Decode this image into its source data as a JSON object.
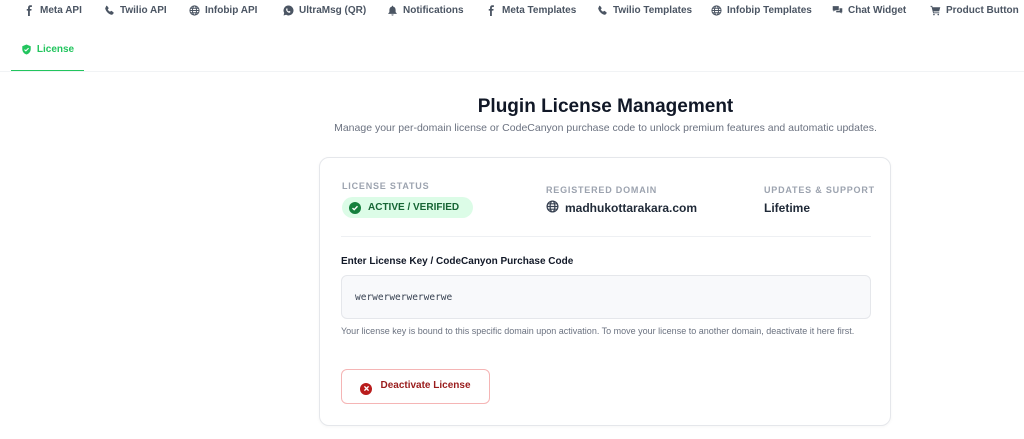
{
  "tabs": [
    {
      "id": "meta-api",
      "label": "Meta API",
      "icon": "facebook-icon"
    },
    {
      "id": "twilio-api",
      "label": "Twilio API",
      "icon": "phone-icon"
    },
    {
      "id": "infobip-api",
      "label": "Infobip API",
      "icon": "globe-icon"
    },
    {
      "id": "ultramsg",
      "label": "UltraMsg (QR)",
      "icon": "whatsapp-icon"
    },
    {
      "id": "notifications",
      "label": "Notifications",
      "icon": "bell-icon"
    },
    {
      "id": "meta-templates",
      "label": "Meta Templates",
      "icon": "facebook-icon"
    },
    {
      "id": "twilio-templates",
      "label": "Twilio Templates",
      "icon": "phone-icon"
    },
    {
      "id": "infobip-templates",
      "label": "Infobip Templates",
      "icon": "globe-icon"
    },
    {
      "id": "chat-widget",
      "label": "Chat Widget",
      "icon": "chat-icon"
    },
    {
      "id": "product-button",
      "label": "Product Button",
      "icon": "cart-icon"
    }
  ],
  "active_tab": {
    "label": "License",
    "icon": "shield-icon",
    "color": "#22c55e"
  },
  "page": {
    "title": "Plugin License Management",
    "subtitle": "Manage your per-domain license or CodeCanyon purchase code to unlock premium features and automatic updates."
  },
  "status": {
    "license_status_label": "LICENSE STATUS",
    "license_status_value": "ACTIVE / VERIFIED",
    "domain_label": "REGISTERED DOMAIN",
    "domain_value": "madhukottarakara.com",
    "updates_label": "UPDATES & SUPPORT",
    "updates_value": "Lifetime"
  },
  "license_form": {
    "label": "Enter License Key / CodeCanyon Purchase Code",
    "value": "werwerwerwerwerwe",
    "help": "Your license key is bound to this specific domain upon activation. To move your license to another domain, deactivate it here first.",
    "deactivate_label": "Deactivate License"
  },
  "colors": {
    "accent": "#22c55e",
    "success_bg": "#dcfce7",
    "danger": "#b91c1c"
  }
}
